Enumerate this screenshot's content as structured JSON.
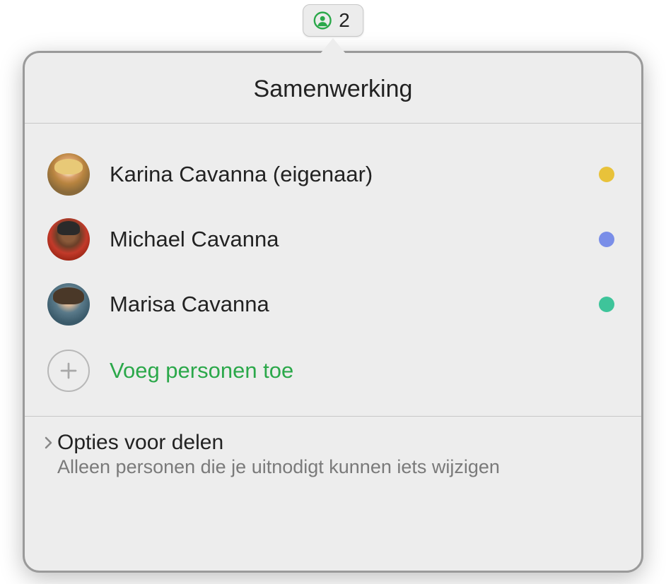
{
  "pill": {
    "count": "2"
  },
  "popover": {
    "title": "Samenwerking",
    "participants": [
      {
        "name": "Karina Cavanna (eigenaar)",
        "status_color": "#e8c23a"
      },
      {
        "name": "Michael Cavanna",
        "status_color": "#7a8ee8"
      },
      {
        "name": "Marisa Cavanna",
        "status_color": "#3ec49a"
      }
    ],
    "add_people_label": "Voeg personen toe",
    "footer": {
      "title": "Opties voor delen",
      "subtitle": "Alleen personen die je uitnodigt kunnen iets wijzigen"
    }
  }
}
